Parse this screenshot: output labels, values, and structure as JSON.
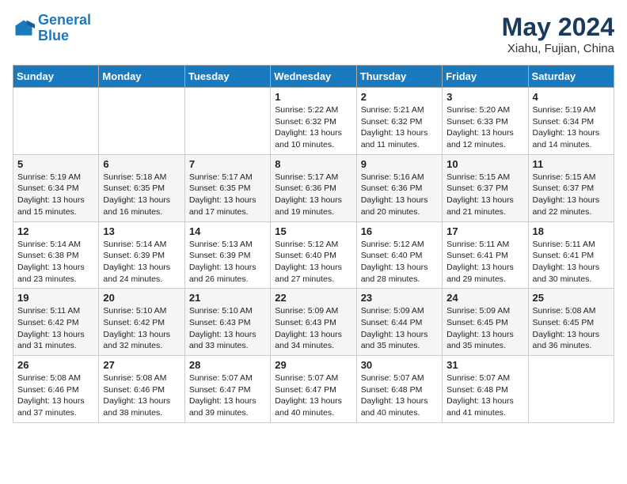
{
  "logo": {
    "line1": "General",
    "line2": "Blue"
  },
  "title": "May 2024",
  "subtitle": "Xiahu, Fujian, China",
  "headers": [
    "Sunday",
    "Monday",
    "Tuesday",
    "Wednesday",
    "Thursday",
    "Friday",
    "Saturday"
  ],
  "weeks": [
    [
      {
        "day": "",
        "info": ""
      },
      {
        "day": "",
        "info": ""
      },
      {
        "day": "",
        "info": ""
      },
      {
        "day": "1",
        "info": "Sunrise: 5:22 AM\nSunset: 6:32 PM\nDaylight: 13 hours\nand 10 minutes."
      },
      {
        "day": "2",
        "info": "Sunrise: 5:21 AM\nSunset: 6:32 PM\nDaylight: 13 hours\nand 11 minutes."
      },
      {
        "day": "3",
        "info": "Sunrise: 5:20 AM\nSunset: 6:33 PM\nDaylight: 13 hours\nand 12 minutes."
      },
      {
        "day": "4",
        "info": "Sunrise: 5:19 AM\nSunset: 6:34 PM\nDaylight: 13 hours\nand 14 minutes."
      }
    ],
    [
      {
        "day": "5",
        "info": "Sunrise: 5:19 AM\nSunset: 6:34 PM\nDaylight: 13 hours\nand 15 minutes."
      },
      {
        "day": "6",
        "info": "Sunrise: 5:18 AM\nSunset: 6:35 PM\nDaylight: 13 hours\nand 16 minutes."
      },
      {
        "day": "7",
        "info": "Sunrise: 5:17 AM\nSunset: 6:35 PM\nDaylight: 13 hours\nand 17 minutes."
      },
      {
        "day": "8",
        "info": "Sunrise: 5:17 AM\nSunset: 6:36 PM\nDaylight: 13 hours\nand 19 minutes."
      },
      {
        "day": "9",
        "info": "Sunrise: 5:16 AM\nSunset: 6:36 PM\nDaylight: 13 hours\nand 20 minutes."
      },
      {
        "day": "10",
        "info": "Sunrise: 5:15 AM\nSunset: 6:37 PM\nDaylight: 13 hours\nand 21 minutes."
      },
      {
        "day": "11",
        "info": "Sunrise: 5:15 AM\nSunset: 6:37 PM\nDaylight: 13 hours\nand 22 minutes."
      }
    ],
    [
      {
        "day": "12",
        "info": "Sunrise: 5:14 AM\nSunset: 6:38 PM\nDaylight: 13 hours\nand 23 minutes."
      },
      {
        "day": "13",
        "info": "Sunrise: 5:14 AM\nSunset: 6:39 PM\nDaylight: 13 hours\nand 24 minutes."
      },
      {
        "day": "14",
        "info": "Sunrise: 5:13 AM\nSunset: 6:39 PM\nDaylight: 13 hours\nand 26 minutes."
      },
      {
        "day": "15",
        "info": "Sunrise: 5:12 AM\nSunset: 6:40 PM\nDaylight: 13 hours\nand 27 minutes."
      },
      {
        "day": "16",
        "info": "Sunrise: 5:12 AM\nSunset: 6:40 PM\nDaylight: 13 hours\nand 28 minutes."
      },
      {
        "day": "17",
        "info": "Sunrise: 5:11 AM\nSunset: 6:41 PM\nDaylight: 13 hours\nand 29 minutes."
      },
      {
        "day": "18",
        "info": "Sunrise: 5:11 AM\nSunset: 6:41 PM\nDaylight: 13 hours\nand 30 minutes."
      }
    ],
    [
      {
        "day": "19",
        "info": "Sunrise: 5:11 AM\nSunset: 6:42 PM\nDaylight: 13 hours\nand 31 minutes."
      },
      {
        "day": "20",
        "info": "Sunrise: 5:10 AM\nSunset: 6:42 PM\nDaylight: 13 hours\nand 32 minutes."
      },
      {
        "day": "21",
        "info": "Sunrise: 5:10 AM\nSunset: 6:43 PM\nDaylight: 13 hours\nand 33 minutes."
      },
      {
        "day": "22",
        "info": "Sunrise: 5:09 AM\nSunset: 6:43 PM\nDaylight: 13 hours\nand 34 minutes."
      },
      {
        "day": "23",
        "info": "Sunrise: 5:09 AM\nSunset: 6:44 PM\nDaylight: 13 hours\nand 35 minutes."
      },
      {
        "day": "24",
        "info": "Sunrise: 5:09 AM\nSunset: 6:45 PM\nDaylight: 13 hours\nand 35 minutes."
      },
      {
        "day": "25",
        "info": "Sunrise: 5:08 AM\nSunset: 6:45 PM\nDaylight: 13 hours\nand 36 minutes."
      }
    ],
    [
      {
        "day": "26",
        "info": "Sunrise: 5:08 AM\nSunset: 6:46 PM\nDaylight: 13 hours\nand 37 minutes."
      },
      {
        "day": "27",
        "info": "Sunrise: 5:08 AM\nSunset: 6:46 PM\nDaylight: 13 hours\nand 38 minutes."
      },
      {
        "day": "28",
        "info": "Sunrise: 5:07 AM\nSunset: 6:47 PM\nDaylight: 13 hours\nand 39 minutes."
      },
      {
        "day": "29",
        "info": "Sunrise: 5:07 AM\nSunset: 6:47 PM\nDaylight: 13 hours\nand 40 minutes."
      },
      {
        "day": "30",
        "info": "Sunrise: 5:07 AM\nSunset: 6:48 PM\nDaylight: 13 hours\nand 40 minutes."
      },
      {
        "day": "31",
        "info": "Sunrise: 5:07 AM\nSunset: 6:48 PM\nDaylight: 13 hours\nand 41 minutes."
      },
      {
        "day": "",
        "info": ""
      }
    ]
  ]
}
